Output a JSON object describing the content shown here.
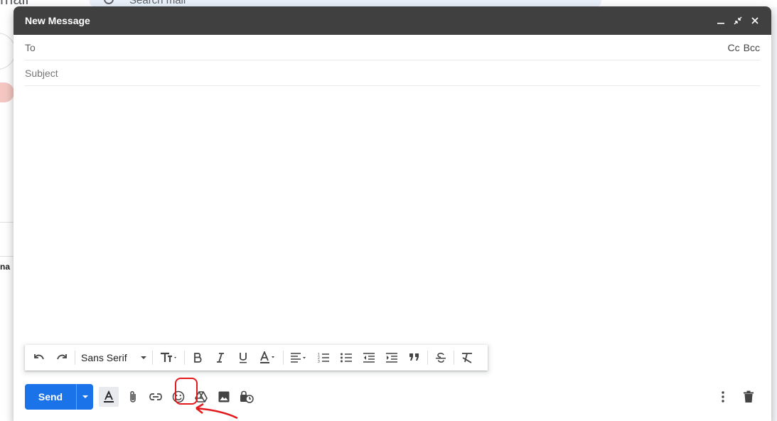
{
  "background": {
    "logo_text": "mail",
    "search_placeholder": "Search mail",
    "side_text": "na"
  },
  "compose": {
    "title": "New Message",
    "window_buttons": [
      "minimize-icon",
      "fullscreen-exit-icon",
      "close-icon"
    ],
    "to": {
      "label": "To",
      "value": "",
      "cc": "Cc",
      "bcc": "Bcc"
    },
    "subject": {
      "placeholder": "Subject",
      "value": ""
    },
    "body": ""
  },
  "format_toolbar": {
    "font": "Sans Serif",
    "items": [
      "undo-icon",
      "redo-icon",
      "font-select",
      "text-size-icon",
      "bold-icon",
      "italic-icon",
      "underline-icon",
      "text-color-icon",
      "align-icon",
      "numbered-list-icon",
      "bulleted-list-icon",
      "indent-less-icon",
      "indent-more-icon",
      "quote-icon",
      "strikethrough-icon",
      "remove-formatting-icon"
    ]
  },
  "bottom_toolbar": {
    "send_label": "Send",
    "icons": [
      "formatting-options-icon",
      "attach-file-icon",
      "insert-link-icon",
      "insert-emoji-icon",
      "google-drive-icon",
      "insert-photo-icon",
      "confidential-mode-icon"
    ],
    "right_icons": [
      "more-options-icon",
      "discard-draft-icon"
    ]
  },
  "annotation": {
    "highlighted": "google-drive-icon",
    "color": "#e3191b"
  }
}
